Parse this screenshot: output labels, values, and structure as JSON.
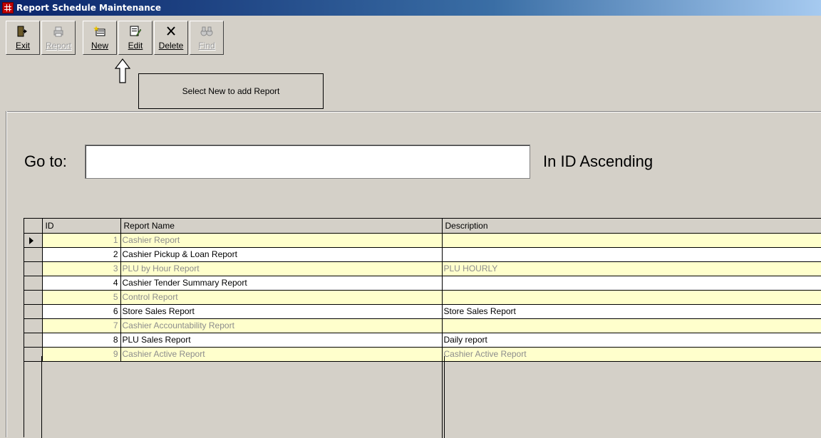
{
  "window": {
    "title": "Report Schedule Maintenance"
  },
  "toolbar": {
    "buttons": [
      {
        "label": "Exit",
        "icon": "exit-door-icon",
        "enabled": true
      },
      {
        "label": "Report",
        "icon": "printer-icon",
        "enabled": false
      },
      {
        "label": "New",
        "icon": "new-record-icon",
        "enabled": true
      },
      {
        "label": "Edit",
        "icon": "edit-record-icon",
        "enabled": true
      },
      {
        "label": "Delete",
        "icon": "delete-x-icon",
        "enabled": true
      },
      {
        "label": "Find",
        "icon": "binoculars-icon",
        "enabled": false
      }
    ]
  },
  "hint": {
    "text": "Select New to add Report"
  },
  "goto": {
    "label": "Go to:",
    "value": "",
    "sort_label": "In ID Ascending"
  },
  "grid": {
    "columns": [
      "ID",
      "Report Name",
      "Description"
    ],
    "rows": [
      {
        "id": "1",
        "name": "Cashier Report",
        "description": ""
      },
      {
        "id": "2",
        "name": "Cashier Pickup & Loan Report",
        "description": ""
      },
      {
        "id": "3",
        "name": "PLU by Hour Report",
        "description": "PLU HOURLY"
      },
      {
        "id": "4",
        "name": "Cashier Tender Summary Report",
        "description": ""
      },
      {
        "id": "5",
        "name": "Control Report",
        "description": ""
      },
      {
        "id": "6",
        "name": "Store Sales Report",
        "description": "Store Sales Report"
      },
      {
        "id": "7",
        "name": "Cashier Accountability Report",
        "description": ""
      },
      {
        "id": "8",
        "name": "PLU Sales Report",
        "description": "Daily report"
      },
      {
        "id": "9",
        "name": "Cashier Active Report",
        "description": "Cashier Active Report"
      }
    ]
  },
  "colors": {
    "title_bar": "#0a246a",
    "row_alt": "#ffffcc",
    "row_alt_text": "#8c8c8c"
  }
}
